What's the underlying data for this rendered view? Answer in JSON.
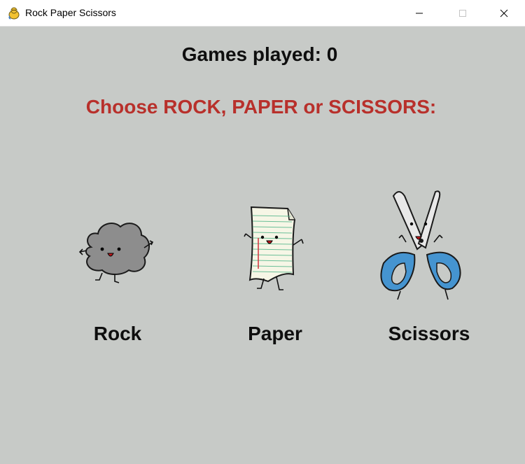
{
  "window": {
    "title": "Rock Paper Scissors",
    "icon": "pygame-snake-icon",
    "controls": [
      "minimize-icon",
      "maximize-icon",
      "close-icon"
    ]
  },
  "game": {
    "games_played_label": "Games played: 0",
    "prompt": "Choose ROCK, PAPER or SCISSORS:",
    "prompt_color": "#b8302b",
    "background": "#c7cac7",
    "choices": [
      {
        "label": "Rock",
        "icon": "rock-character-icon"
      },
      {
        "label": "Paper",
        "icon": "paper-character-icon"
      },
      {
        "label": "Scissors",
        "icon": "scissors-character-icon"
      }
    ]
  }
}
